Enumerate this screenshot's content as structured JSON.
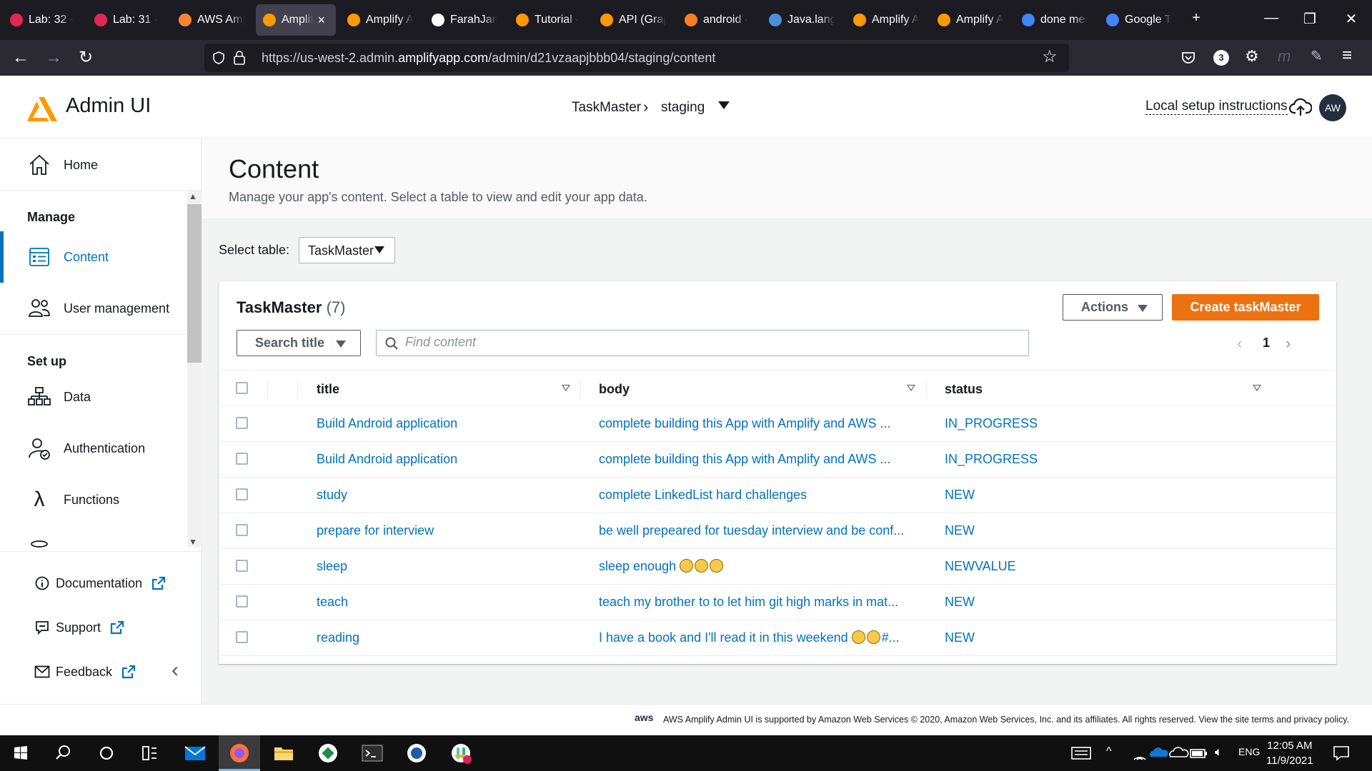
{
  "browser": {
    "tabs": [
      {
        "label": "Lab: 32 -",
        "icon": "lab-icon",
        "color": "#e22850"
      },
      {
        "label": "Lab: 31 -",
        "icon": "lab-icon",
        "color": "#e22850"
      },
      {
        "label": "AWS Amp",
        "icon": "aws-icon",
        "color": "#f58536"
      },
      {
        "label": "Amplif",
        "icon": "amplify-icon",
        "color": "#ff9900",
        "active": true
      },
      {
        "label": "Amplify A",
        "icon": "amplify-icon",
        "color": "#ff9900"
      },
      {
        "label": "FarahJam",
        "icon": "github-icon",
        "color": "#ffffff"
      },
      {
        "label": "Tutorial -",
        "icon": "amplify-icon",
        "color": "#ff9900"
      },
      {
        "label": "API (Grap",
        "icon": "amplify-icon",
        "color": "#ff9900"
      },
      {
        "label": "android -",
        "icon": "stackoverflow-icon",
        "color": "#f48024"
      },
      {
        "label": "Java.lang",
        "icon": "doc-icon",
        "color": "#4a90d9"
      },
      {
        "label": "Amplify A",
        "icon": "amplify-icon",
        "color": "#ff9900"
      },
      {
        "label": "Amplify A",
        "icon": "amplify-icon",
        "color": "#ff9900"
      },
      {
        "label": "done mer",
        "icon": "google-icon",
        "color": "#4285f4"
      },
      {
        "label": "Google Tr",
        "icon": "translate-icon",
        "color": "#4285f4"
      }
    ],
    "url_prefix": "https://us-west-2.admin.",
    "url_domain": "amplifyapp.com",
    "url_path": "/admin/d21vzaapjbbb04/staging/content",
    "badge_count": "3"
  },
  "header": {
    "app_title": "Admin UI",
    "breadcrumb_app": "TaskMaster",
    "breadcrumb_env": "staging",
    "setup_link": "Local setup instructions",
    "avatar_initials": "AW"
  },
  "sidebar": {
    "home": "Home",
    "manage_heading": "Manage",
    "content": "Content",
    "user_management": "User management",
    "setup_heading": "Set up",
    "data": "Data",
    "authentication": "Authentication",
    "functions": "Functions",
    "documentation": "Documentation",
    "support": "Support",
    "feedback": "Feedback"
  },
  "main": {
    "title": "Content",
    "description": "Manage your app's content. Select a table to view and edit your app data.",
    "select_label": "Select table:",
    "selected_table": "TaskMaster",
    "table_title": "TaskMaster",
    "table_count": "(7)",
    "actions_label": "Actions",
    "create_label": "Create taskMaster",
    "search_by": "Search title",
    "search_placeholder": "Find content",
    "page": "1",
    "columns": [
      "title",
      "body",
      "status"
    ],
    "rows": [
      {
        "title": "Build Android application",
        "body": "complete building this App with Amplify and AWS ...",
        "status": "IN_PROGRESS"
      },
      {
        "title": "Build Android application",
        "body": "complete building this App with Amplify and AWS ...",
        "status": "IN_PROGRESS"
      },
      {
        "title": "study",
        "body": "complete LinkedList hard challenges",
        "status": "NEW"
      },
      {
        "title": "prepare for interview",
        "body": "be well prepeared for tuesday interview and be conf...",
        "status": "NEW"
      },
      {
        "title": "sleep",
        "body": "sleep enough",
        "body_emoji": 3,
        "status": "NEWVALUE"
      },
      {
        "title": "teach",
        "body": "teach my brother to to let him git high marks in mat...",
        "status": "NEW"
      },
      {
        "title": "reading",
        "body": "I have a book and I'll read it in this weekend",
        "body_emoji": 2,
        "body_suffix": "#...",
        "status": "NEW"
      }
    ]
  },
  "footer": {
    "aws_mark": "aws",
    "text": "AWS Amplify Admin UI is supported by Amazon Web Services © 2020, Amazon Web Services, Inc. and its affiliates. All rights reserved. View the site terms and privacy policy."
  },
  "taskbar": {
    "lang": "ENG",
    "time": "12:05 AM",
    "date": "11/9/2021"
  },
  "colors": {
    "accent": "#ec7211",
    "link": "#0073bb",
    "active_nav": "#0073bb"
  }
}
